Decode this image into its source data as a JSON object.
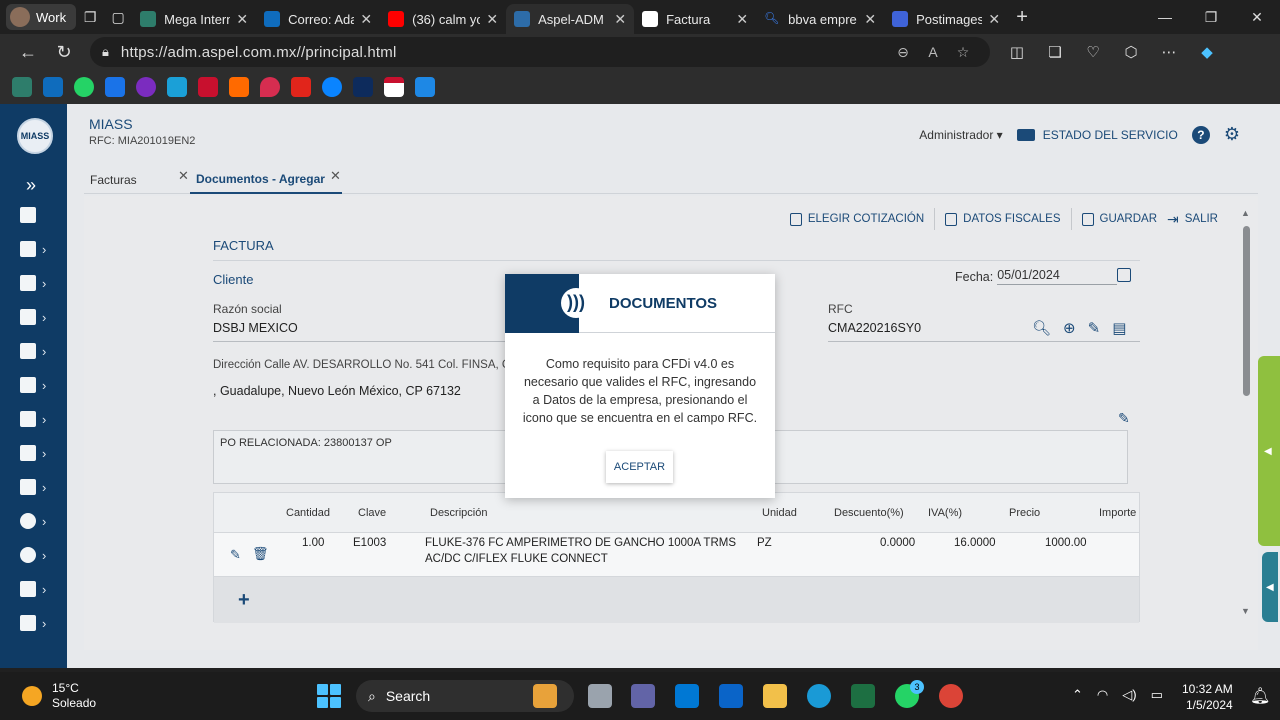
{
  "browser": {
    "profile": "Work",
    "tabs": [
      {
        "label": "Mega Intern",
        "color": "#2e7d6b"
      },
      {
        "label": "Correo: Ada",
        "color": "#0f6cbd"
      },
      {
        "label": "(36) calm yo",
        "color": "#ff0000"
      },
      {
        "label": "Aspel-ADM",
        "color": "#2d6ca8"
      },
      {
        "label": "Factura",
        "color": "#ffffff"
      },
      {
        "label": "bbva empre",
        "color": "#3b82f6"
      },
      {
        "label": "Postimages",
        "color": "#3f63d8"
      }
    ],
    "url": "https://adm.aspel.com.mx//principal.html"
  },
  "app": {
    "company": "MIASS",
    "rfc": "RFC: MIA201019EN2",
    "logo": "MIASS",
    "user": "Administrador",
    "service_status": "ESTADO DEL SERVICIO",
    "tabs": [
      {
        "label": "Facturas"
      },
      {
        "label": "Documentos - Agregar"
      }
    ],
    "actions": {
      "elegir": "ELEGIR COTIZACIÓN",
      "datos": "DATOS FISCALES",
      "guardar": "GUARDAR",
      "salir": "SALIR"
    },
    "form": {
      "section_title": "FACTURA",
      "cliente": "Cliente",
      "fecha_label": "Fecha:",
      "fecha_value": "05/01/2024",
      "razon_label": "Razón social",
      "razon_value": "DSBJ MEXICO",
      "rfc_label": "RFC",
      "rfc_value": "CMA220216SY0",
      "direccion": "Dirección Calle AV. DESARROLLO No. 541 Col. FINSA, G",
      "direccion2": ", Guadalupe, Nuevo León México, CP 67132",
      "observaciones": "PO RELACIONADA: 23800137 OP"
    },
    "grid": {
      "headers": {
        "cantidad": "Cantidad",
        "clave": "Clave",
        "descripcion": "Descripción",
        "unidad": "Unidad",
        "descuento": "Descuento(%)",
        "iva": "IVA(%)",
        "precio": "Precio",
        "importe": "Importe"
      },
      "row": {
        "cantidad": "1.00",
        "clave": "E1003",
        "descripcion1": "FLUKE-376 FC AMPERIMETRO DE GANCHO 1000A TRMS",
        "descripcion2": "AC/DC C/IFLEX FLUKE CONNECT",
        "unidad": "PZ",
        "descuento": "0.0000",
        "iva": "16.0000",
        "precio": "1000.00"
      }
    }
  },
  "modal": {
    "title": "DOCUMENTOS",
    "body": "Como requisito para CFDi v4.0 es necesario que valides el RFC, ingresando a Datos de la empresa, presionando el icono que se encuentra en el campo RFC.",
    "button": "ACEPTAR"
  },
  "taskbar": {
    "temp": "15°C",
    "condition": "Soleado",
    "search": "Search",
    "whatsapp_badge": "3",
    "time": "10:32 AM",
    "date": "1/5/2024"
  }
}
